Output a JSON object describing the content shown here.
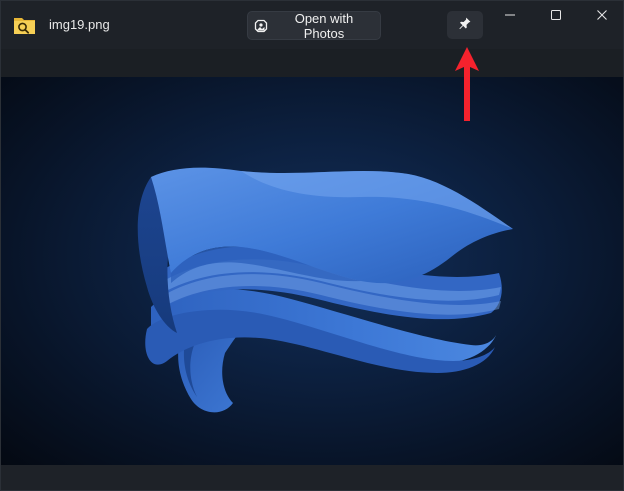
{
  "window": {
    "file_name": "img19.png"
  },
  "toolbar": {
    "open_with_label": "Open with Photos"
  },
  "icons": {
    "app": "folder-magnifier-icon",
    "open_with": "photos-app-icon",
    "pin": "pin-icon",
    "minimize": "minimize-icon",
    "maximize": "maximize-icon",
    "close": "close-icon",
    "annotation": "red-arrow-up-icon"
  },
  "colors": {
    "accent": "#f5222d",
    "titlebar": "#1e2228",
    "wallpaper_blue": "#3a78d4"
  }
}
